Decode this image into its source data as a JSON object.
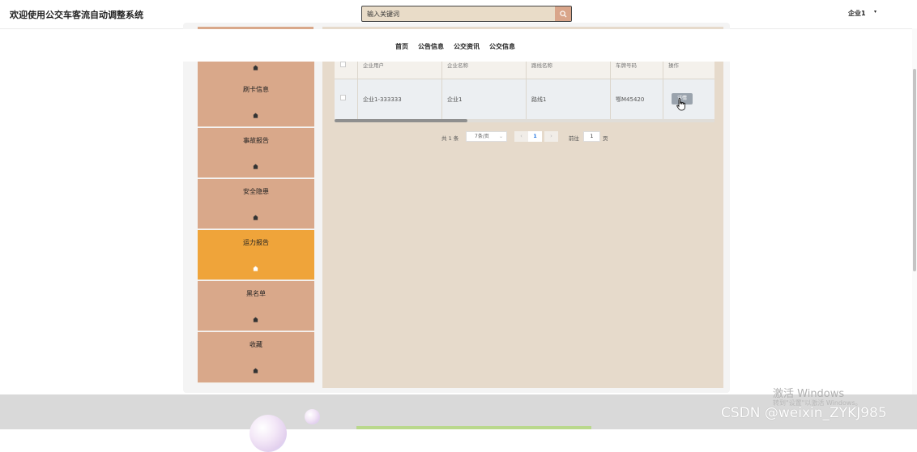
{
  "header": {
    "title": "欢迎使用公交车客流自动调整系统",
    "search_placeholder": "输入关键词",
    "user": "企业1"
  },
  "nav": {
    "items": [
      "首页",
      "公告信息",
      "公交资讯",
      "公交信息"
    ]
  },
  "sidebar": {
    "items": [
      {
        "label": "",
        "active": false
      },
      {
        "label": "刷卡信息",
        "active": false
      },
      {
        "label": "事故报告",
        "active": false
      },
      {
        "label": "安全隐患",
        "active": false
      },
      {
        "label": "运力报告",
        "active": true
      },
      {
        "label": "黑名单",
        "active": false
      },
      {
        "label": "收藏",
        "active": false
      }
    ]
  },
  "table": {
    "columns": [
      "企业用户",
      "企业名称",
      "路线名称",
      "车牌号码",
      "操作"
    ],
    "rows": [
      {
        "user": "企业1-333333",
        "company": "企业1",
        "route": "路线1",
        "plate": "鄂M45420",
        "action": "详情"
      }
    ]
  },
  "pagination": {
    "total": "共 1 条",
    "page_size": "7条/页",
    "current": "1",
    "goto_label": "前往",
    "goto_value": "1",
    "page_unit": "页"
  },
  "watermark": {
    "title": "激活 Windows",
    "subtitle": "转到\"设置\"以激活 Windows。",
    "csdn": "CSDN @weixin_ZYKJ985"
  },
  "colors": {
    "sidebar": "#d9a88a",
    "sidebar_active": "#efa43a",
    "panel": "#e6dacb"
  }
}
